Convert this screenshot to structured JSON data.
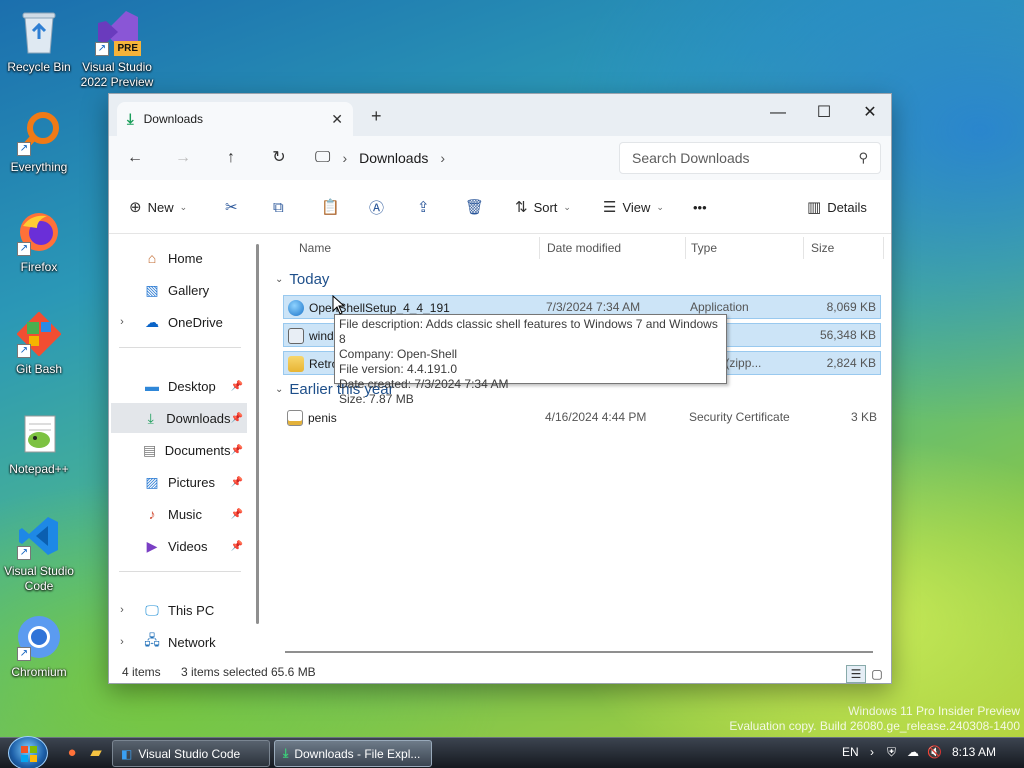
{
  "desktop": {
    "icons": [
      {
        "label": "Recycle Bin"
      },
      {
        "label": "Visual Studio 2022 Preview",
        "badge": "PRE"
      },
      {
        "label": "Everything"
      },
      {
        "label": "Firefox"
      },
      {
        "label": "Git Bash"
      },
      {
        "label": "Notepad++"
      },
      {
        "label": "Visual Studio Code"
      },
      {
        "label": "Chromium"
      }
    ],
    "watermark": {
      "line1": "Windows 11 Pro Insider Preview",
      "line2": "Evaluation copy. Build 26080.ge_release.240308-1400"
    }
  },
  "explorer": {
    "tab_title": "Downloads",
    "new_tab": "+",
    "address": {
      "segments": [
        "Downloads"
      ]
    },
    "search_placeholder": "Search Downloads",
    "toolbar": {
      "new_label": "New",
      "sort_label": "Sort",
      "view_label": "View",
      "more_label": "•••",
      "details_label": "Details"
    },
    "sidebar": {
      "home": "Home",
      "gallery": "Gallery",
      "onedrive": "OneDrive",
      "desktop": "Desktop",
      "downloads": "Downloads",
      "documents": "Documents",
      "pictures": "Pictures",
      "music": "Music",
      "videos": "Videos",
      "this_pc": "This PC",
      "network": "Network"
    },
    "columns": {
      "name": "Name",
      "date": "Date modified",
      "type": "Type",
      "size": "Size"
    },
    "groups": {
      "today": "Today",
      "earlier": "Earlier this year"
    },
    "files": [
      {
        "name": "OpenShellSetup_4_4_191",
        "date": "7/3/2024 7:34 AM",
        "type": "Application",
        "size": "8,069 KB",
        "icon": "app-icon",
        "selected": true
      },
      {
        "name": "wind",
        "date": "",
        "type": "ation",
        "size": "56,348 KB",
        "icon": "installer-icon",
        "selected": true
      },
      {
        "name": "Retro",
        "date": "",
        "type": "essed (zipp...",
        "size": "2,824 KB",
        "icon": "zip-folder-icon",
        "selected": true
      },
      {
        "name": "penis",
        "date": "4/16/2024 4:44 PM",
        "type": "Security Certificate",
        "size": "3 KB",
        "icon": "certificate-icon",
        "selected": false
      }
    ],
    "tooltip": {
      "description": "File description: Adds classic shell features to Windows 7 and Windows 8",
      "company": "Company: Open-Shell",
      "version": "File version: 4.4.191.0",
      "created": "Date created: 7/3/2024 7:34 AM",
      "size": "Size: 7.87 MB"
    },
    "status": {
      "items": "4 items",
      "selected": "3 items selected",
      "selected_size": "65.6 MB"
    }
  },
  "taskbar": {
    "buttons": [
      {
        "label": "Visual Studio Code",
        "active": false
      },
      {
        "label": "Downloads - File Expl...",
        "active": true
      }
    ],
    "language": "EN",
    "time": "8:13 AM"
  },
  "colors": {
    "accent": "#0067c0",
    "selection": "#cce4f7",
    "folder": "#f5c342",
    "downloads_green": "#1a9e5a"
  }
}
